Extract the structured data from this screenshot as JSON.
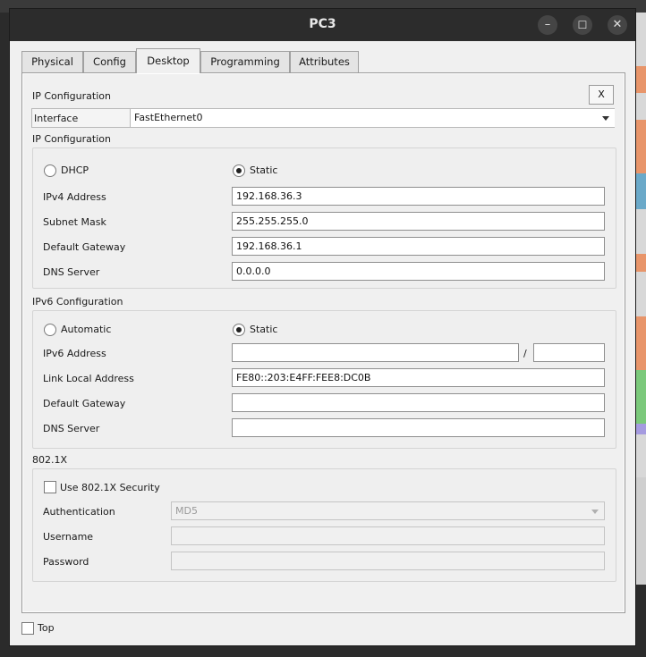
{
  "window": {
    "title": "PC3",
    "controls": {
      "minimize": "–",
      "maximize": "☐",
      "close": "✕"
    }
  },
  "tabs": [
    {
      "label": "Physical"
    },
    {
      "label": "Config"
    },
    {
      "label": "Desktop",
      "active": true
    },
    {
      "label": "Programming"
    },
    {
      "label": "Attributes"
    }
  ],
  "ipconfig": {
    "header": "IP Configuration",
    "close_label": "X",
    "interface_label": "Interface",
    "interface_value": "FastEthernet0",
    "ipv4_section": "IP Configuration",
    "dhcp_label": "DHCP",
    "static_label": "Static",
    "mode": "Static",
    "ipv4_address_label": "IPv4 Address",
    "ipv4_address": "192.168.36.3",
    "subnet_mask_label": "Subnet Mask",
    "subnet_mask": "255.255.255.0",
    "default_gateway_label": "Default Gateway",
    "default_gateway": "192.168.36.1",
    "dns_server_label": "DNS Server",
    "dns_server": "0.0.0.0"
  },
  "ipv6": {
    "section": "IPv6 Configuration",
    "automatic_label": "Automatic",
    "static_label": "Static",
    "mode": "Static",
    "address_label": "IPv6 Address",
    "address": "",
    "slash": "/",
    "prefix": "",
    "link_local_label": "Link Local Address",
    "link_local": "FE80::203:E4FF:FEE8:DC0B",
    "default_gateway_label": "Default Gateway",
    "default_gateway": "",
    "dns_server_label": "DNS Server",
    "dns_server": ""
  },
  "dot1x": {
    "section": "802.1X",
    "use_security_label": "Use 802.1X Security",
    "use_security": false,
    "authentication_label": "Authentication",
    "authentication": "MD5",
    "username_label": "Username",
    "username": "",
    "password_label": "Password",
    "password": ""
  },
  "footer": {
    "top_label": "Top",
    "top_checked": false
  }
}
